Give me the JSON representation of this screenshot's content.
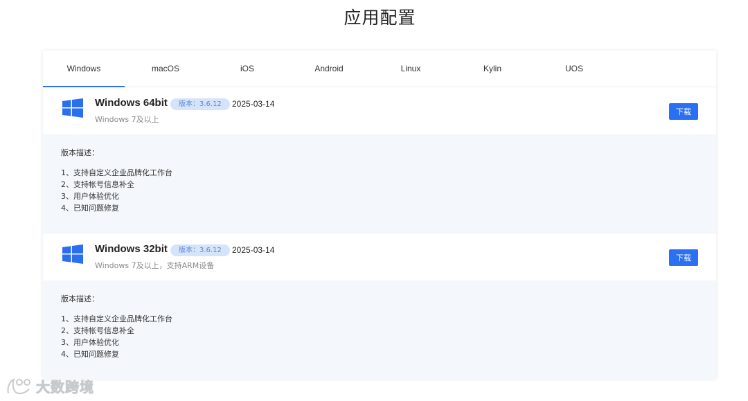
{
  "page": {
    "title": "应用配置"
  },
  "tabs": [
    {
      "label": "Windows",
      "active": true
    },
    {
      "label": "macOS",
      "active": false
    },
    {
      "label": "iOS",
      "active": false
    },
    {
      "label": "Android",
      "active": false
    },
    {
      "label": "Linux",
      "active": false
    },
    {
      "label": "Kylin",
      "active": false
    },
    {
      "label": "UOS",
      "active": false
    }
  ],
  "releases": [
    {
      "icon": "windows-logo-icon",
      "name": "Windows 64bit",
      "version": "版本：3.6.12",
      "date": "2025-03-14",
      "requirement": "Windows 7及以上",
      "download_label": "下载",
      "description_label": "版本描述：",
      "description_items": [
        "1、支持自定义企业品牌化工作台",
        "2、支持帐号信息补全",
        "3、用户体验优化",
        "4、已知问题修复"
      ]
    },
    {
      "icon": "windows-logo-icon",
      "name": "Windows 32bit",
      "version": "版本：3.6.12",
      "date": "2025-03-14",
      "requirement": "Windows 7及以上，支持ARM设备",
      "download_label": "下载",
      "description_label": "版本描述：",
      "description_items": [
        "1、支持自定义企业品牌化工作台",
        "2、支持帐号信息补全",
        "3、用户体验优化",
        "4、已知问题修复"
      ]
    }
  ],
  "watermark": {
    "text": "大数跨境",
    "icon": "brand-logo-icon"
  },
  "colors": {
    "accent": "#2b6ff2",
    "windows_logo": "#2a6ff0",
    "badge_bg": "#d6e4fb",
    "badge_text": "#5d87cf",
    "body_bg": "#f4f7fb"
  }
}
